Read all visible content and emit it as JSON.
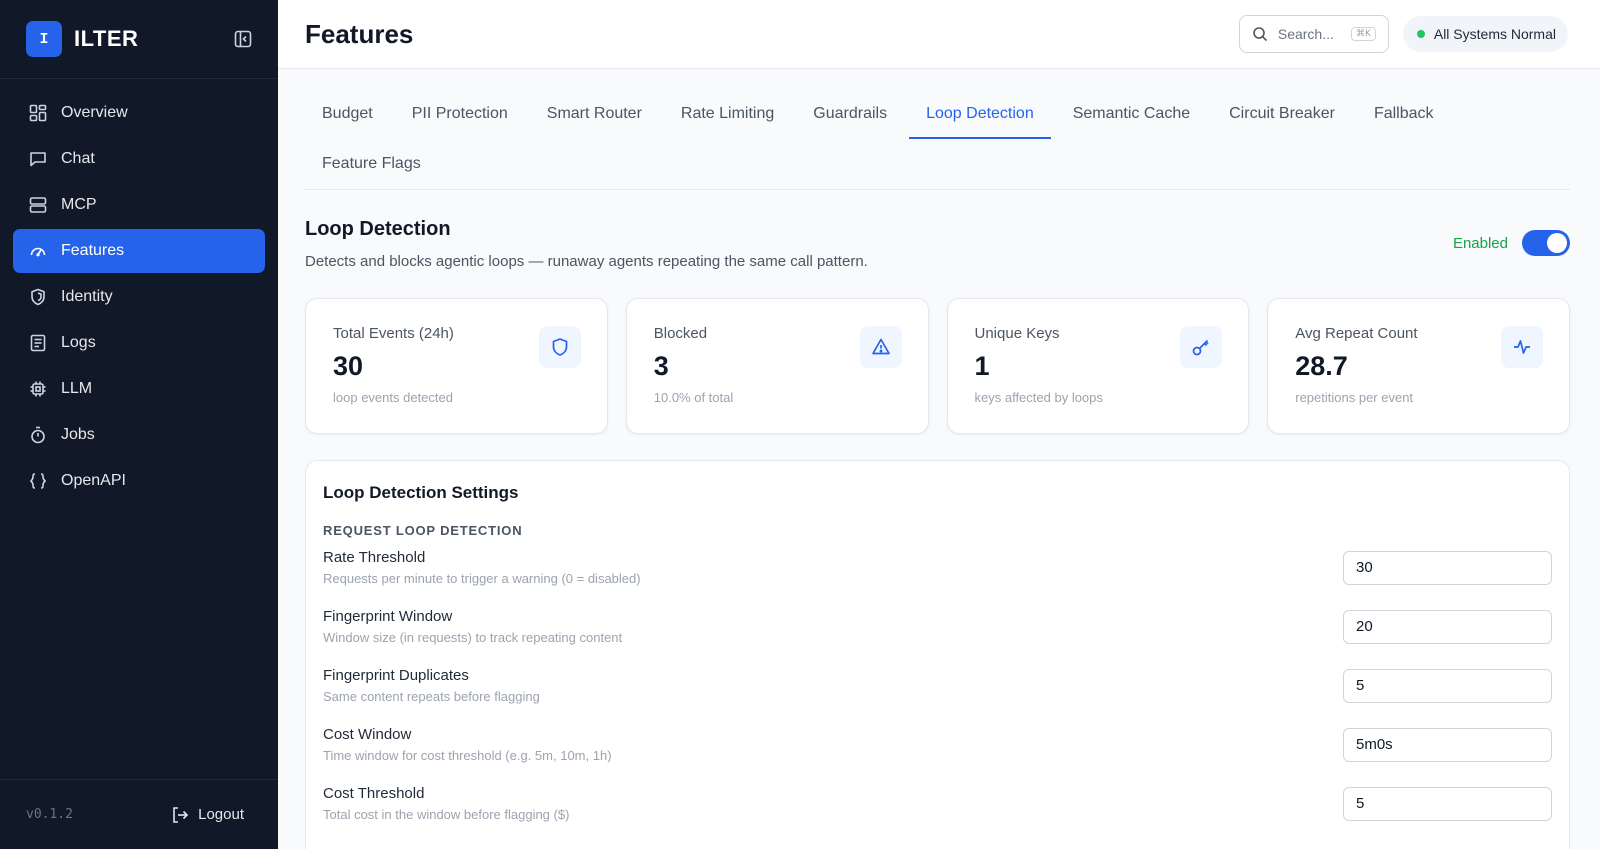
{
  "app": {
    "logo_letter": "I",
    "name": "ILTER",
    "version": "v0.1.2",
    "logout_label": "Logout"
  },
  "sidebar": {
    "items": [
      {
        "label": "Overview",
        "icon": "grid-icon"
      },
      {
        "label": "Chat",
        "icon": "chat-bubble-icon"
      },
      {
        "label": "MCP",
        "icon": "server-icon"
      },
      {
        "label": "Features",
        "icon": "gauge-icon",
        "active": true
      },
      {
        "label": "Identity",
        "icon": "shield-icon"
      },
      {
        "label": "Logs",
        "icon": "document-icon"
      },
      {
        "label": "LLM",
        "icon": "chip-icon"
      },
      {
        "label": "Jobs",
        "icon": "stopwatch-icon"
      },
      {
        "label": "OpenAPI",
        "icon": "braces-icon"
      }
    ]
  },
  "header": {
    "title": "Features",
    "search_placeholder": "Search...",
    "search_shortcut": "⌘K",
    "status_text": "All Systems Normal",
    "status_color": "#22c55e"
  },
  "tabs": [
    {
      "label": "Budget"
    },
    {
      "label": "PII Protection"
    },
    {
      "label": "Smart Router"
    },
    {
      "label": "Rate Limiting"
    },
    {
      "label": "Guardrails"
    },
    {
      "label": "Loop Detection",
      "active": true
    },
    {
      "label": "Semantic Cache"
    },
    {
      "label": "Circuit Breaker"
    },
    {
      "label": "Fallback"
    },
    {
      "label": "Feature Flags"
    }
  ],
  "section": {
    "title": "Loop Detection",
    "description": "Detects and blocks agentic loops — runaway agents repeating the same call pattern.",
    "toggle_label": "Enabled",
    "enabled": true
  },
  "stats": [
    {
      "label": "Total Events (24h)",
      "value": "30",
      "sub": "loop events detected",
      "icon": "shield-icon"
    },
    {
      "label": "Blocked",
      "value": "3",
      "sub": "10.0% of total",
      "icon": "warning-triangle-icon"
    },
    {
      "label": "Unique Keys",
      "value": "1",
      "sub": "keys affected by loops",
      "icon": "key-icon"
    },
    {
      "label": "Avg Repeat Count",
      "value": "28.7",
      "sub": "repetitions per event",
      "icon": "activity-icon"
    }
  ],
  "settings": {
    "title": "Loop Detection Settings",
    "subhead": "REQUEST LOOP DETECTION",
    "fields": [
      {
        "label": "Rate Threshold",
        "help": "Requests per minute to trigger a warning (0 = disabled)",
        "value": "30"
      },
      {
        "label": "Fingerprint Window",
        "help": "Window size (in requests) to track repeating content",
        "value": "20"
      },
      {
        "label": "Fingerprint Duplicates",
        "help": "Same content repeats before flagging",
        "value": "5"
      },
      {
        "label": "Cost Window",
        "help": "Time window for cost threshold (e.g. 5m, 10m, 1h)",
        "value": "5m0s"
      },
      {
        "label": "Cost Threshold",
        "help": "Total cost in the window before flagging ($)",
        "value": "5"
      }
    ]
  },
  "colors": {
    "accent": "#2563eb",
    "sidebar_bg": "#111827",
    "enabled_green": "#16a34a"
  }
}
